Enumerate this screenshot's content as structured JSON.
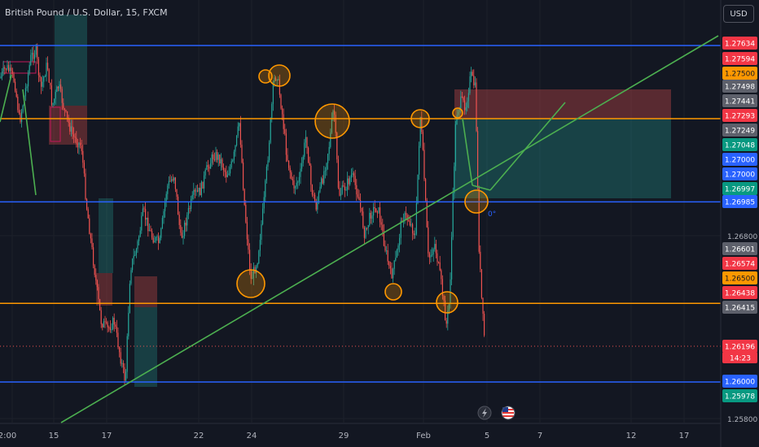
{
  "header": {
    "title": "British Pound / U.S. Dollar, 15, FXCM",
    "currency": "USD"
  },
  "colors": {
    "background": "#131722",
    "up": "#26a69a",
    "down": "#ef5350",
    "blue": "#2962ff",
    "orange": "#ff9800",
    "green": "#4caf50",
    "grid": "#1e222d",
    "text": "#b2b5be"
  },
  "chart_data": {
    "type": "candlestick",
    "x_tick_labels": [
      "2:00",
      "15",
      "17",
      "22",
      "24",
      "29",
      "Feb",
      "5",
      "7",
      "12",
      "17"
    ],
    "y_range": [
      1.257,
      1.2785
    ],
    "y_tick_labels": [
      "1.26800",
      "1.25800"
    ],
    "price_labels": [
      {
        "value": "1.27634",
        "kind": "red"
      },
      {
        "value": "1.27594",
        "kind": "red"
      },
      {
        "value": "1.27500",
        "kind": "orange"
      },
      {
        "value": "1.27498",
        "kind": "gray"
      },
      {
        "value": "1.27441",
        "kind": "gray"
      },
      {
        "value": "1.27293",
        "kind": "red"
      },
      {
        "value": "1.27249",
        "kind": "gray"
      },
      {
        "value": "1.27048",
        "kind": "green"
      },
      {
        "value": "1.27000",
        "kind": "blue"
      },
      {
        "value": "1.27000",
        "kind": "blue"
      },
      {
        "value": "1.26997",
        "kind": "green"
      },
      {
        "value": "1.26985",
        "kind": "blue"
      },
      {
        "value": "1.26601",
        "kind": "gray"
      },
      {
        "value": "1.26574",
        "kind": "red"
      },
      {
        "value": "1.26500",
        "kind": "orange"
      },
      {
        "value": "1.26438",
        "kind": "red"
      },
      {
        "value": "1.26415",
        "kind": "gray"
      },
      {
        "value": "1.26196",
        "kind": "red"
      },
      {
        "value": "1.26000",
        "kind": "blue"
      },
      {
        "value": "1.25978",
        "kind": "green"
      }
    ],
    "countdown": "14:23",
    "horizontal_levels": [
      {
        "price": 1.2784,
        "color": "blue"
      },
      {
        "price": 1.2744,
        "color": "orange"
      },
      {
        "price": 1.26985,
        "color": "blue"
      },
      {
        "price": 1.2643,
        "color": "orange"
      },
      {
        "price": 1.26,
        "color": "blue"
      }
    ],
    "annotation_text": "0°"
  }
}
